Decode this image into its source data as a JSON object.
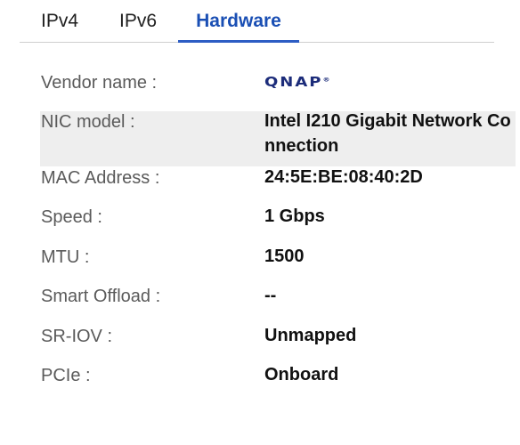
{
  "tabs": [
    {
      "label": "IPv4"
    },
    {
      "label": "IPv6"
    },
    {
      "label": "Hardware",
      "active": true
    }
  ],
  "accent_color": "#1a4fb4",
  "vendor_logo": {
    "text": "QNAP",
    "mark": "®",
    "color": "#1c2c7a"
  },
  "fields": [
    {
      "label": "Vendor name :",
      "value": ""
    },
    {
      "label": "NIC model :",
      "value": "Intel I210 Gigabit Network Connection"
    },
    {
      "label": "MAC Address :",
      "value": "24:5E:BE:08:40:2D"
    },
    {
      "label": "Speed :",
      "value": "1 Gbps"
    },
    {
      "label": "MTU :",
      "value": "1500"
    },
    {
      "label": "Smart Offload :",
      "value": "--"
    },
    {
      "label": "SR-IOV :",
      "value": "Unmapped"
    },
    {
      "label": "PCIe :",
      "value": "Onboard"
    }
  ]
}
